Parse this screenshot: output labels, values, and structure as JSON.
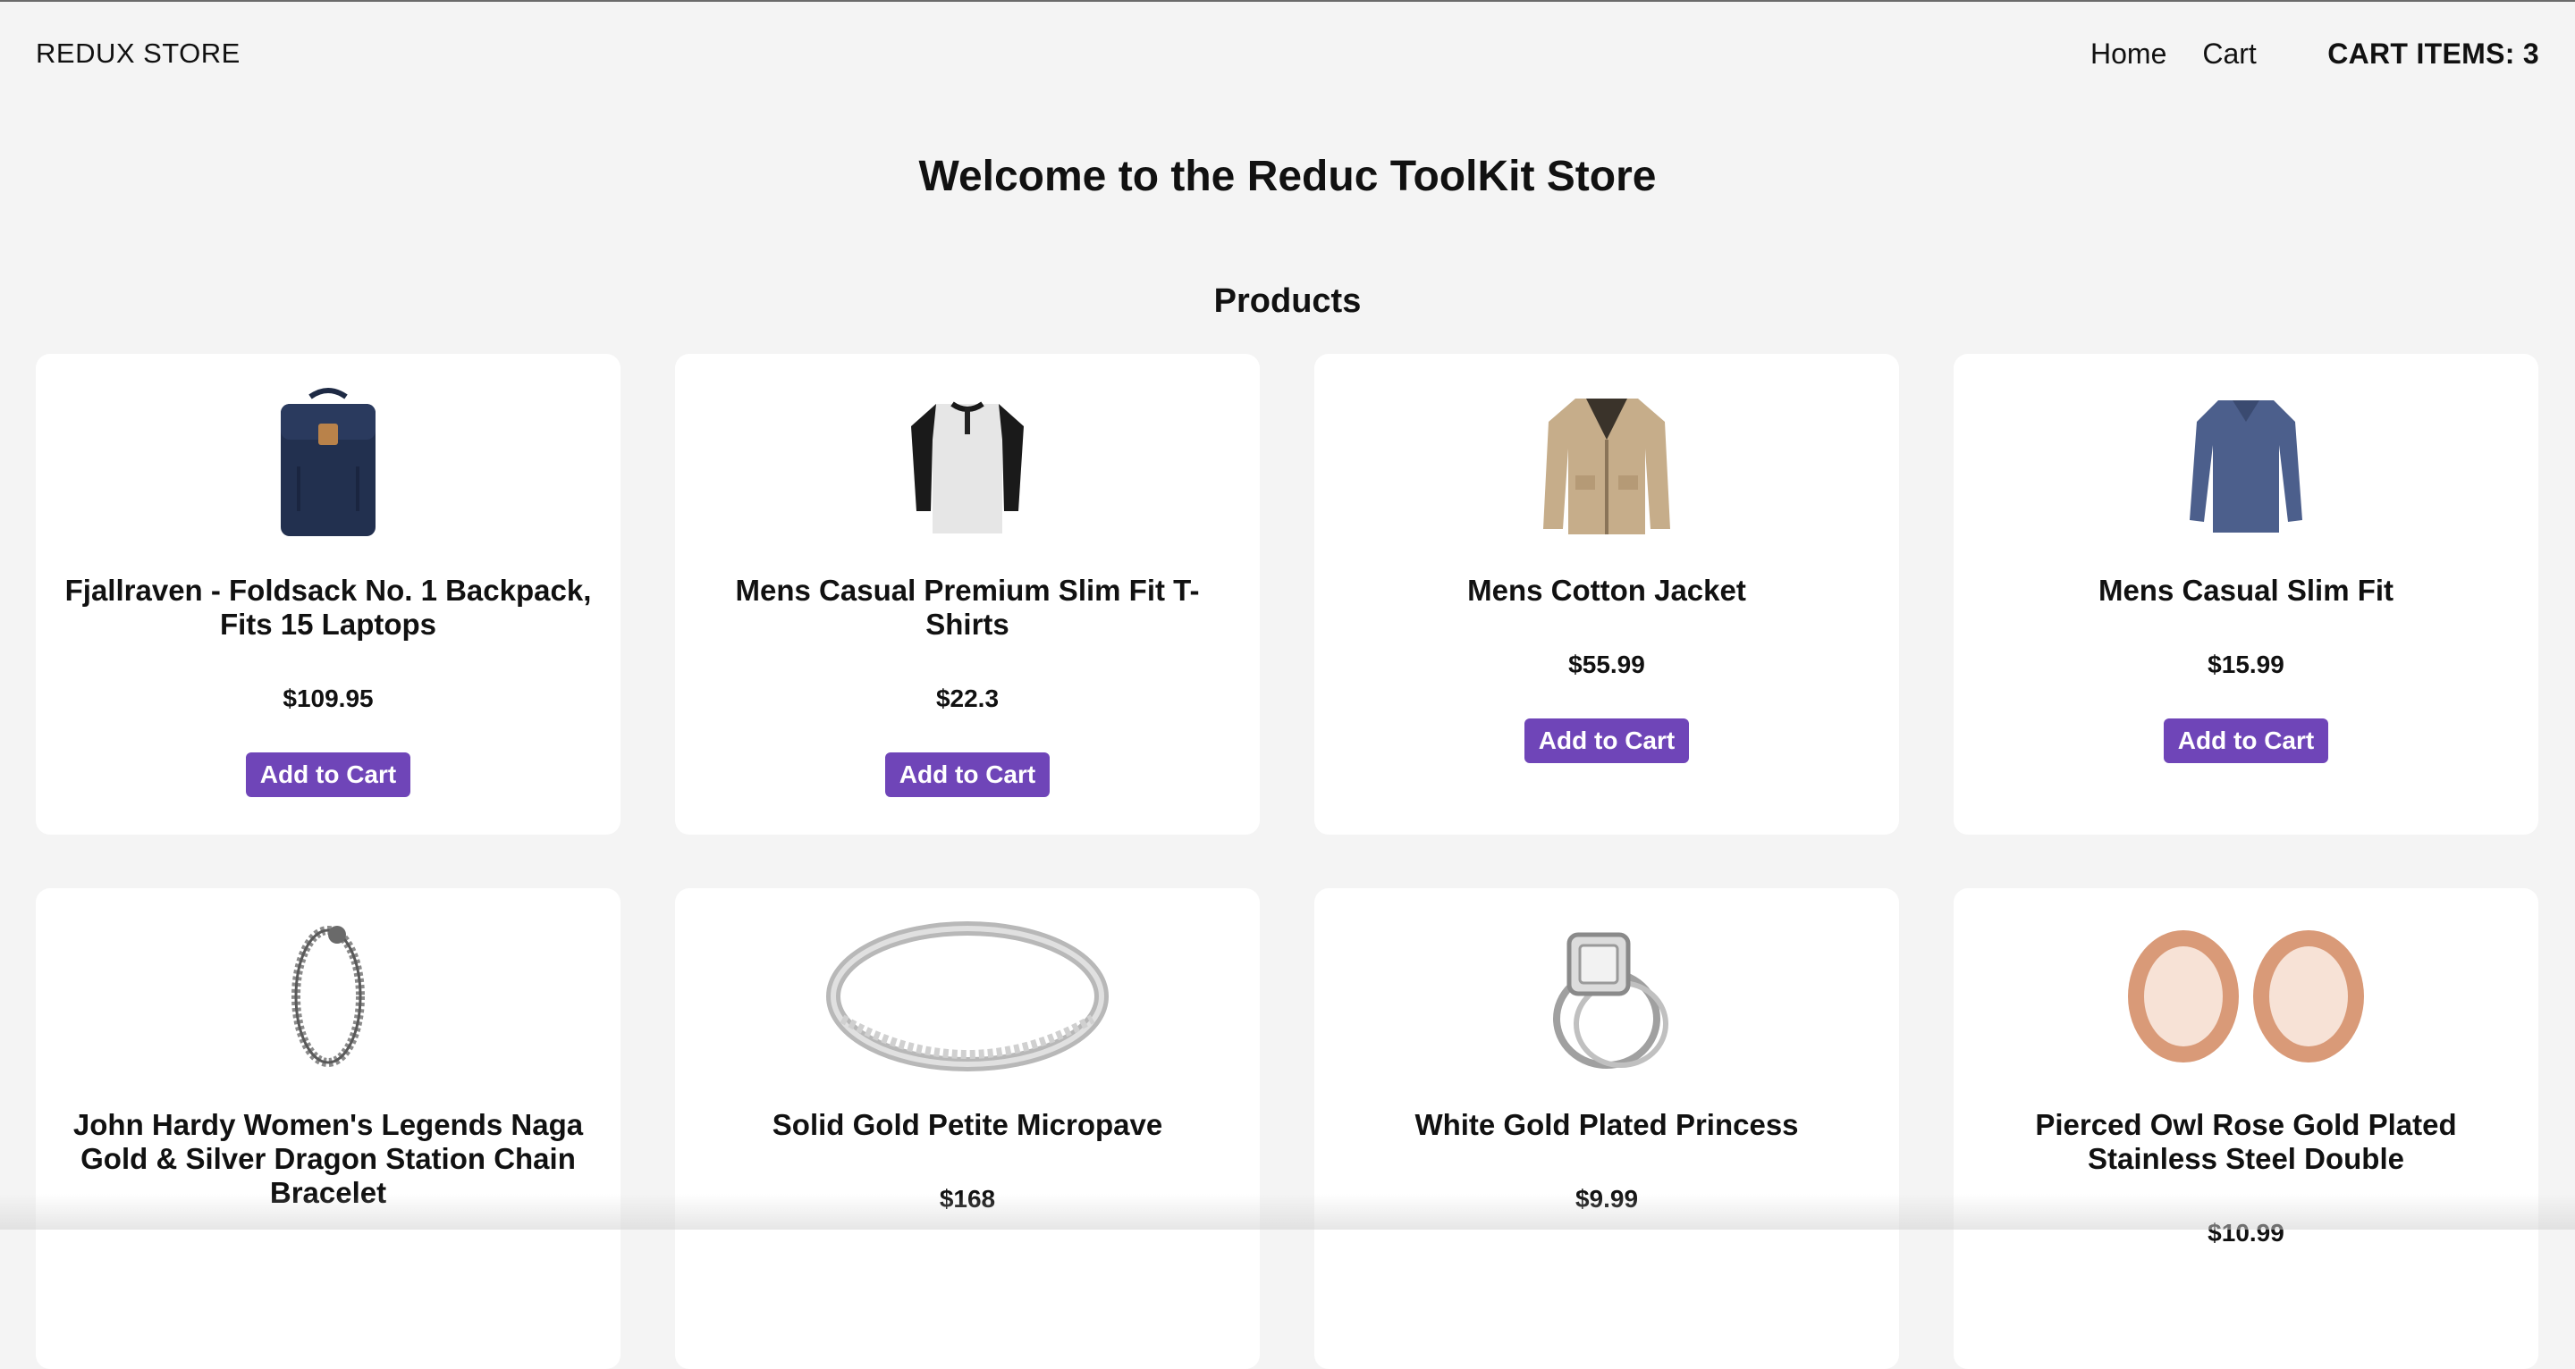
{
  "navbar": {
    "brand": "REDUX STORE",
    "links": [
      "Home",
      "Cart"
    ],
    "cart_count": "CART ITEMS: 3"
  },
  "welcome": "Welcome to the Reduc ToolKit Store",
  "products_heading": "Products",
  "add_to_cart_label": "Add to Cart",
  "products": [
    {
      "title": "Fjallraven - Foldsack No. 1 Backpack, Fits 15 Laptops",
      "price": "$109.95",
      "icon": "backpack-image"
    },
    {
      "title": "Mens Casual Premium Slim Fit T-Shirts",
      "price": "$22.3",
      "icon": "henley-shirt-image"
    },
    {
      "title": "Mens Cotton Jacket",
      "price": "$55.99",
      "icon": "jacket-image"
    },
    {
      "title": "Mens Casual Slim Fit",
      "price": "$15.99",
      "icon": "long-sleeve-shirt-image"
    },
    {
      "title": "John Hardy Women's Legends Naga Gold & Silver Dragon Station Chain Bracelet",
      "price": "",
      "icon": "bracelet-image"
    },
    {
      "title": "Solid Gold Petite Micropave",
      "price": "$168",
      "icon": "ring-image"
    },
    {
      "title": "White Gold Plated Princess",
      "price": "$9.99",
      "icon": "diamond-ring-image"
    },
    {
      "title": "Pierced Owl Rose Gold Plated Stainless Steel Double",
      "price": "$10.99",
      "icon": "rose-gold-plugs-image"
    }
  ],
  "colors": {
    "background": "#f4f4f4",
    "card": "#ffffff",
    "button": "#6f45b8"
  }
}
